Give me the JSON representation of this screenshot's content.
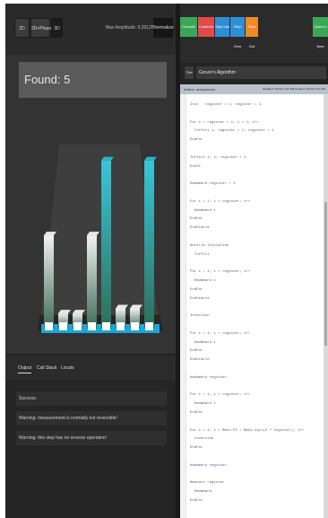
{
  "toolbar": {
    "view_2d": "2D",
    "view_2d_phase": "2D+Phase",
    "view_3d": "3D",
    "max_amplitude": "Max Amplitude: 0.291258",
    "normalize": "Normalize"
  },
  "viz": {
    "found_label": "Found: 5",
    "bars": [
      {
        "state": "0",
        "amplitude": 0.74,
        "color": "#e8e8e8"
      },
      {
        "state": "1",
        "amplitude": 0.12,
        "color": "#e8e8e8"
      },
      {
        "state": "2",
        "amplitude": 0.12,
        "color": "#e8e8e8"
      },
      {
        "state": "3",
        "amplitude": 0.74,
        "color": "#e8e8e8"
      },
      {
        "state": "4",
        "amplitude": 1.0,
        "color": "#2bb5c8"
      },
      {
        "state": "5",
        "amplitude": 0.12,
        "color": "#e8e8e8"
      },
      {
        "state": "6",
        "amplitude": 0.12,
        "color": "#e8e8e8"
      },
      {
        "state": "7",
        "amplitude": 1.0,
        "color": "#2bb5c8"
      }
    ],
    "colors": {
      "base": "#1aa7d8",
      "highlight": "#2bb5c8",
      "neutral": "#e8e8e8"
    }
  },
  "bottom": {
    "tabs": [
      "Output",
      "Call Stack",
      "Locals"
    ],
    "messages": [
      "Success.",
      "Warning: measurement is normally not reversible!",
      "Warning: this step has no reverse operation!"
    ]
  },
  "actions": {
    "compile": "Compile",
    "continue": "Continue",
    "step_into": "Step Into",
    "step_over": "Step Over",
    "step_out": "Step Out",
    "open": "Open In New"
  },
  "editor": {
    "title_tag": "Title",
    "title": "Grover's Algorithm",
    "author": "Author: anonymous",
    "dates": "Modified: 4/27/14 4:30 PM   Created: 3/11/14 9:21 AM",
    "code_lines": [
      "Init   register = 1; register = 1",
      "",
      "For i = register + 1; i < 1; i++",
      "  Toffoli i; register = i; register + 1",
      "EndFor",
      "",
      "Toffoli i; i; register + 1",
      "EndIf",
      "",
      "Hadamard register + 1",
      "",
      "For i = 1; i < register; i++",
      "  Hadamard i",
      "EndFor",
      "EndOracle",
      "",
      "Ancilla Initialize",
      "  Toffoli",
      "",
      "For i = 1; i < register; i++",
      "  Hadamard i",
      "EndFor",
      "EndOracle",
      "",
      "Inversion",
      "",
      "For i = 1; i < register; i++",
      "  Hadamard i",
      "EndFor",
      "EndOracle",
      "",
      "Hadamard register",
      "",
      "For i = 1; i < register; i++",
      "  Hadamard i",
      "EndFor",
      "",
      "For i = 1; i < Math.PI / Math.sqrt(2 ^ register); i++",
      "  Inversion",
      "EndFor",
      "",
      "Hadamard register",
      "",
      "Measure register",
      "  Hadamard",
      "EndFor"
    ]
  }
}
